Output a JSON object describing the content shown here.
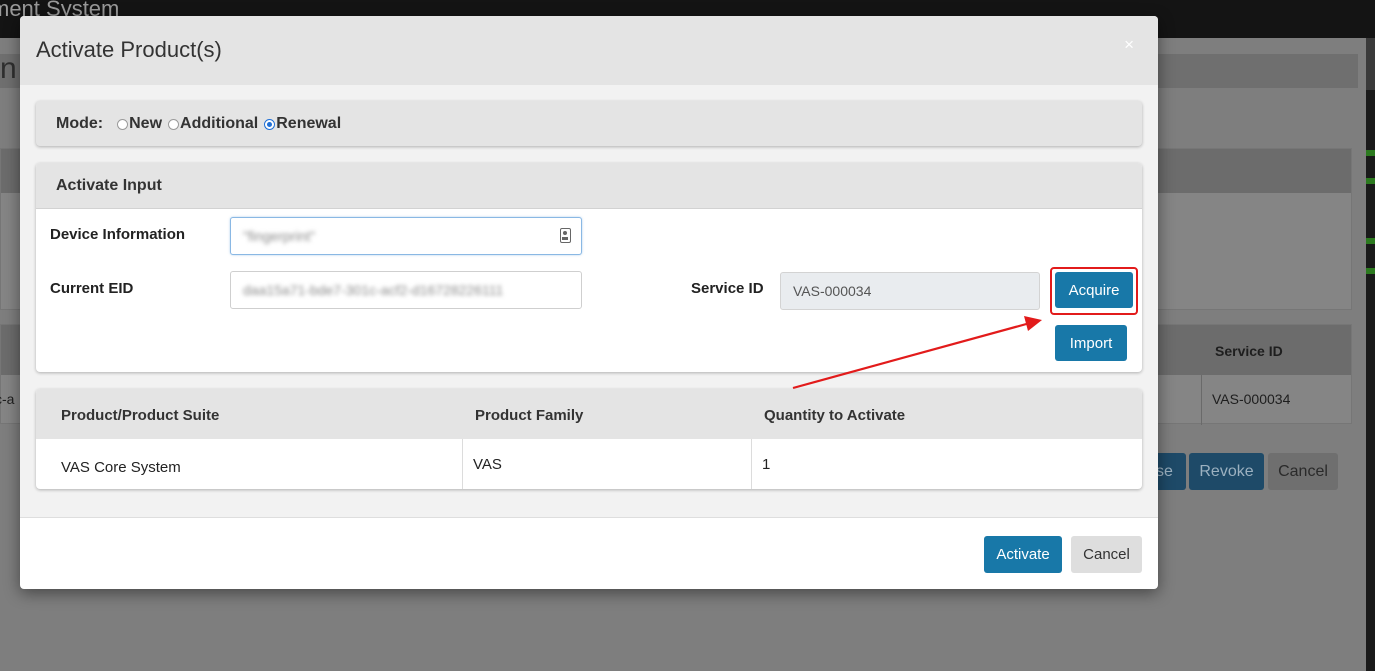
{
  "background": {
    "app_title": "ment System",
    "page_title": "n",
    "table_header_service_id": "Service ID",
    "table_cell_service_id": "VAS-000034",
    "table_cell_left": "c-a",
    "buttons": {
      "release": "se",
      "revoke": "Revoke",
      "cancel": "Cancel"
    }
  },
  "modal": {
    "title": "Activate Product(s)",
    "close_symbol": "×",
    "mode": {
      "label": "Mode:",
      "options": [
        "New",
        "Additional",
        "Renewal"
      ],
      "selected": "Renewal"
    },
    "activate_input": {
      "title": "Activate Input",
      "device_information": {
        "label": "Device Information",
        "value": "\"fingerprint\""
      },
      "current_eid": {
        "label": "Current EID",
        "value": "daa15a71-bde7-301c-acf2-d16728226111"
      },
      "service_id": {
        "label": "Service ID",
        "value": "VAS-000034"
      },
      "acquire_label": "Acquire",
      "import_label": "Import"
    },
    "products_table": {
      "headers": [
        "Product/Product Suite",
        "Product Family",
        "Quantity to Activate"
      ],
      "rows": [
        [
          "VAS Core System",
          "VAS",
          "1"
        ]
      ]
    },
    "footer": {
      "activate_label": "Activate",
      "cancel_label": "Cancel"
    }
  },
  "colors": {
    "primary_button": "#1878a8",
    "highlight_border": "#e21b1b",
    "annotation_arrow": "#e21b1b",
    "radio_selected": "#1f6fd6"
  }
}
